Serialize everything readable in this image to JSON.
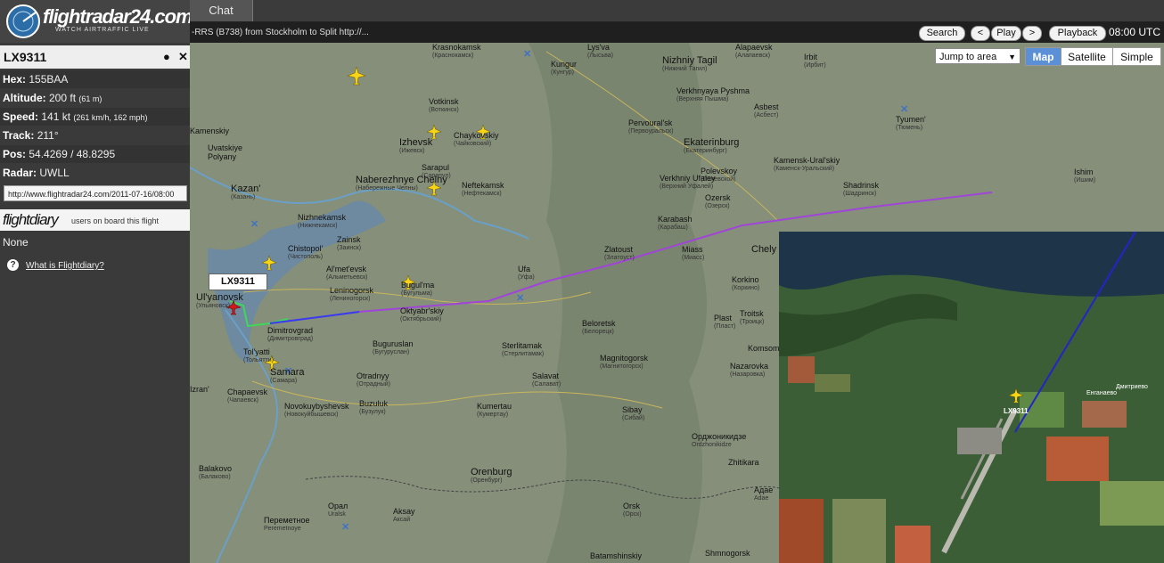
{
  "app": {
    "logo": "flightradar24.com",
    "logo_sub": "WATCH AIRTRAFFIC LIVE",
    "chat_tab": "Chat"
  },
  "ticker": {
    "text": "-RRS (B738) from Stockholm to Split http://...",
    "search": "Search",
    "prev": "<",
    "play": "Play",
    "next": ">",
    "playback": "Playback",
    "time": "08:00 UTC"
  },
  "flight": {
    "callsign": "LX9311",
    "pin_icon": "pin-icon",
    "close_icon": "close-icon",
    "hex_label": "Hex:",
    "hex": "155BAA",
    "alt_label": "Altitude:",
    "alt": "200 ft",
    "alt_sub": "(61 m)",
    "spd_label": "Speed:",
    "spd": "141 kt",
    "spd_sub": "(261 km/h, 162 mph)",
    "trk_label": "Track:",
    "trk": "211°",
    "pos_label": "Pos:",
    "pos": "54.4269 / 48.8295",
    "radar_label": "Radar:",
    "radar": "UWLL",
    "url": "http://www.flightradar24.com/2011-07-16/08:00"
  },
  "flightdiary": {
    "logo": "flightdiary",
    "sub": "users on board this flight",
    "none": "None",
    "help": "What is Flightdiary?"
  },
  "map_controls": {
    "jump": "Jump to area",
    "map": "Map",
    "satellite": "Satellite",
    "simple": "Simple"
  },
  "callout": "LX9311",
  "cities": [
    {
      "name": "Krasnokamsk",
      "cy": "(Краснокамск)"
    },
    {
      "name": "Lys'va",
      "cy": "(Лысьва)"
    },
    {
      "name": "Alapaevsk",
      "cy": "(Алапаевск)"
    },
    {
      "name": "Irbit",
      "cy": "(Ирбит)"
    },
    {
      "name": "Nizhniy Tagil",
      "cy": "(Нижний Тагил)"
    },
    {
      "name": "Kungur",
      "cy": "(Кунгур)"
    },
    {
      "name": "Verkhnyaya Pyshma",
      "cy": "(Верхняя Пышма)"
    },
    {
      "name": "Asbest",
      "cy": "(Асбест)"
    },
    {
      "name": "Votkinsk",
      "cy": "(Воткинск)"
    },
    {
      "name": "Pervoural'sk",
      "cy": "(Первоуральск)"
    },
    {
      "name": "Tyumen'",
      "cy": "(Тюмень)"
    },
    {
      "name": "Izhevsk",
      "cy": "(Ижевск)"
    },
    {
      "name": "Chaykovskiy",
      "cy": "(Чайковский)"
    },
    {
      "name": "Ekaterinburg",
      "cy": "(Екатеринбург)"
    },
    {
      "name": "Kamensk-Ural'skiy",
      "cy": "(Каменск-Уральский)"
    },
    {
      "name": "Sarapul",
      "cy": "(Сарапул)"
    },
    {
      "name": "Polevskoy",
      "cy": "(Полевской)"
    },
    {
      "name": "Ishim",
      "cy": "(Ишим)"
    },
    {
      "name": "Naberezhnye Chelny",
      "cy": "(Набережные Челны)"
    },
    {
      "name": "Neftekamsk",
      "cy": "(Нефтекамск)"
    },
    {
      "name": "Verkhniy Ufaley",
      "cy": "(Верхний Уфалей)"
    },
    {
      "name": "Ozersk",
      "cy": "(Озерск)"
    },
    {
      "name": "Shadrinsk",
      "cy": "(Шадринск)"
    },
    {
      "name": "Kazan'",
      "cy": "(Казань)"
    },
    {
      "name": "Nizhnekamsk",
      "cy": "(Нижнекамск)"
    },
    {
      "name": "Karabash",
      "cy": "(Карабаш)"
    },
    {
      "name": "Chistopol'",
      "cy": "(Чистополь)"
    },
    {
      "name": "Zainsk",
      "cy": "(Заинск)"
    },
    {
      "name": "Zlatoust",
      "cy": "(Златоуст)"
    },
    {
      "name": "Miass",
      "cy": "(Миасс)"
    },
    {
      "name": "Chely",
      "cy": ""
    },
    {
      "name": "Al'met'evsk",
      "cy": "(Альметьевск)"
    },
    {
      "name": "Ufa",
      "cy": "(Уфа)"
    },
    {
      "name": "Leninogorsk",
      "cy": "(Лениногорск)"
    },
    {
      "name": "Bugul'ma",
      "cy": "(Бугульма)"
    },
    {
      "name": "Korkino",
      "cy": "(Коркино)"
    },
    {
      "name": "Ul'yanovsk",
      "cy": "(Ульяновск)"
    },
    {
      "name": "Oktyabr'skiy",
      "cy": "(Октябрьский)"
    },
    {
      "name": "Troitsk",
      "cy": "(Троицк)"
    },
    {
      "name": "Dimitrovgrad",
      "cy": "(Димитровград)"
    },
    {
      "name": "Plast",
      "cy": "(Пласт)"
    },
    {
      "name": "Beloretsk",
      "cy": "(Белорецк)"
    },
    {
      "name": "Buguruslan",
      "cy": "(Бугуруслан)"
    },
    {
      "name": "Sterlitamak",
      "cy": "(Стерлитамак)"
    },
    {
      "name": "Tol'yatti",
      "cy": "(Тольятти)"
    },
    {
      "name": "Magnitogorsk",
      "cy": "(Магнитогорск)"
    },
    {
      "name": "Komsom",
      "cy": ""
    },
    {
      "name": "Nazarovka",
      "cy": "(Назаровка)"
    },
    {
      "name": "Samara",
      "cy": "(Самара)"
    },
    {
      "name": "Otradnyy",
      "cy": "(Отрадный)"
    },
    {
      "name": "Salavat",
      "cy": "(Салават)"
    },
    {
      "name": "Chapaevsk",
      "cy": "(Чапаевск)"
    },
    {
      "name": "Novokuybyshevsk",
      "cy": "(Новокуйбышевск)"
    },
    {
      "name": "Buzuluk",
      "cy": "(Бузулук)"
    },
    {
      "name": "Kumertau",
      "cy": "(Кумертау)"
    },
    {
      "name": "Sibay",
      "cy": "(Сибай)"
    },
    {
      "name": "Ordzhonikidze",
      "cy": "Орджоникидзе"
    },
    {
      "name": "Zhitikara",
      "cy": ""
    },
    {
      "name": "Balakovo",
      "cy": "(Балаково)"
    },
    {
      "name": "Orenburg",
      "cy": "(Оренбург)"
    },
    {
      "name": "Orsk",
      "cy": "(Орск)"
    },
    {
      "name": "Urals",
      "cy": "Орал"
    },
    {
      "name": "Uralsk",
      "cy": ""
    },
    {
      "name": "Aksay",
      "cy": "Аксай"
    },
    {
      "name": "Peremetnoye",
      "cy": "Переметное"
    },
    {
      "name": "Adae",
      "cy": "Адае"
    },
    {
      "name": "Batamshinskiy",
      "cy": ""
    },
    {
      "name": "Shmnogorsk",
      "cy": ""
    },
    {
      "name": "Izran'",
      "cy": ""
    },
    {
      "name": "Kamenskiy",
      "cy": ""
    },
    {
      "name": "Uvatskiye",
      "cy": ""
    },
    {
      "name": "Polyany",
      "cy": ""
    }
  ],
  "sat_labels": {
    "callout": "LX9311",
    "town1": "Дмитриево",
    "town2": "Енганаево"
  },
  "colors": {
    "track_purple": "#a045d8",
    "track_blue": "#3a3af0",
    "track_green": "#3fd65a",
    "aircraft_yellow": "#f7d418",
    "aircraft_red": "#d01818",
    "sidebar_bg": "#3a3a3a"
  }
}
